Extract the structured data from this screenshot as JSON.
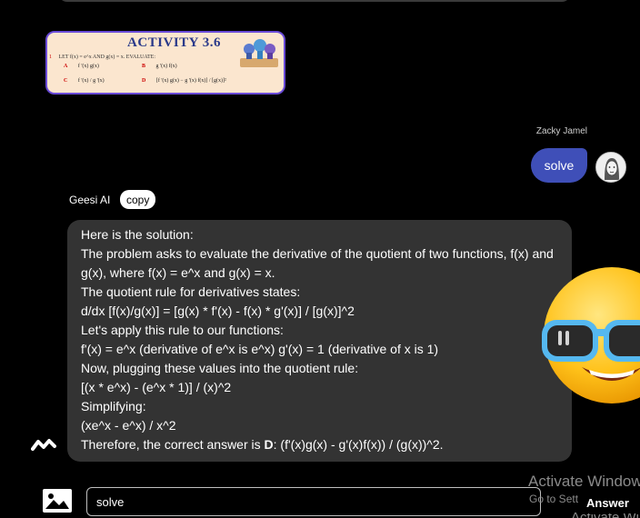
{
  "activity_card": {
    "title": "ACTIVITY 3.6",
    "question_number": "1",
    "question": "LET f(x) = e^x AND g(x) = x. EVALUATE:",
    "options": [
      {
        "letter": "A",
        "text": "f '(x) g(x)"
      },
      {
        "letter": "B",
        "text": "g '(x) f(x)"
      },
      {
        "letter": "C",
        "text": "f '(x) / g '(x)"
      },
      {
        "letter": "D",
        "text": "[f '(x) g(x) − g '(x) f(x)] / [g(x)]²"
      }
    ]
  },
  "user_message": {
    "sender": "Zacky Jamel",
    "text": "solve"
  },
  "ai_message": {
    "sender": "Geesi AI",
    "copy_label": "copy",
    "lines": [
      "Here is the solution:",
      "The problem asks to evaluate the derivative of the quotient of two functions, f(x) and",
      "g(x), where f(x) = e^x and g(x) = x.",
      "The quotient rule for derivatives states:",
      "d/dx [f(x)/g(x)] = [g(x) * f'(x) - f(x) * g'(x)] / [g(x)]^2",
      "Let's apply this rule to our functions:",
      "f'(x) = e^x (derivative of e^x is e^x) g'(x) = 1 (derivative of x is 1)",
      "Now, plugging these values into the quotient rule:",
      "[(x * e^x) - (e^x * 1)] / (x)^2",
      "Simplifying:",
      "(xe^x - e^x) / x^2"
    ],
    "final_prefix": "Therefore, the correct answer is ",
    "final_answer": "D",
    "final_suffix": ": (f'(x)g(x) - g'(x)f(x)) / (g(x))^2."
  },
  "input": {
    "value": "solve",
    "answer_label": "Answer"
  },
  "watermark": {
    "title": "Activate Window",
    "sub": "Go to Settings to activ"
  },
  "colors": {
    "background": "#000000",
    "user_bubble": "#3f4fb8",
    "ai_bubble": "#333333",
    "card_border": "#6a4bd8"
  },
  "icons": [
    "image-icon",
    "wave-icon",
    "sunglasses-emoji",
    "avatar"
  ]
}
